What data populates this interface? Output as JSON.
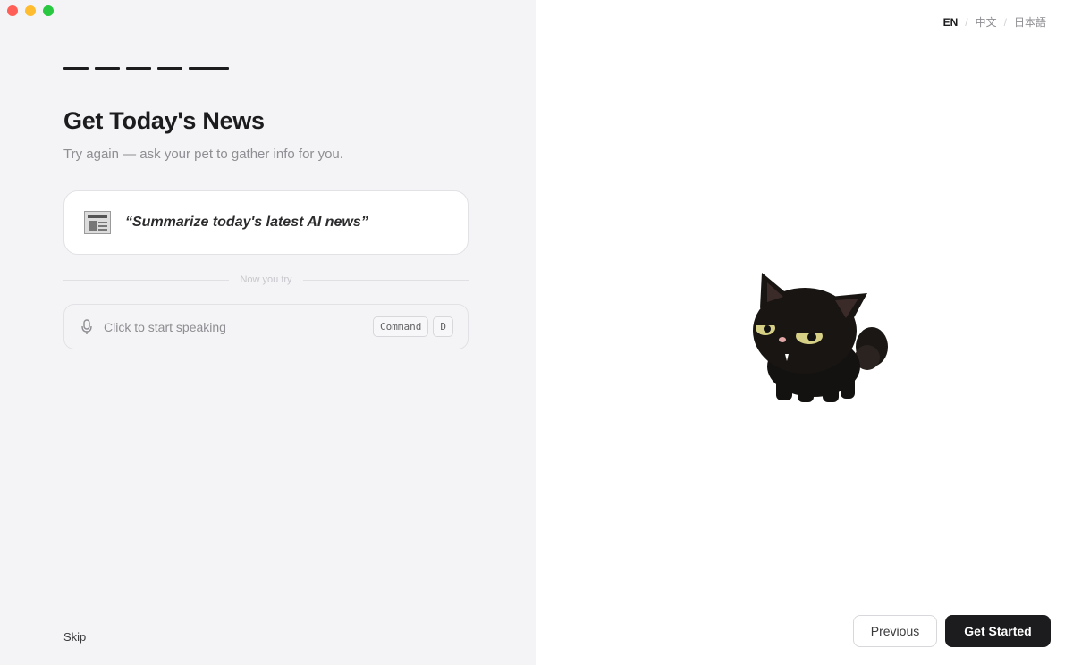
{
  "window": {
    "controls": [
      "close",
      "minimize",
      "maximize"
    ]
  },
  "language": {
    "options": [
      "EN",
      "中文",
      "日本語"
    ],
    "active": "EN"
  },
  "progress": {
    "steps_total": 5,
    "steps_completed": 5
  },
  "header": {
    "title": "Get Today's News",
    "subtitle": "Try again — ask your pet to gather info for you."
  },
  "example": {
    "icon": "newspaper-icon",
    "text": "“Summarize today's latest AI news”"
  },
  "divider": {
    "label": "Now you try"
  },
  "voice": {
    "icon": "microphone-icon",
    "placeholder": "Click to start speaking",
    "shortcut": [
      "Command",
      "D"
    ]
  },
  "footer": {
    "skip_label": "Skip",
    "previous_label": "Previous",
    "start_label": "Get Started"
  },
  "colors": {
    "left_bg": "#f4f4f6",
    "primary_button": "#1c1c1e",
    "accent_text": "#8e8e93"
  }
}
